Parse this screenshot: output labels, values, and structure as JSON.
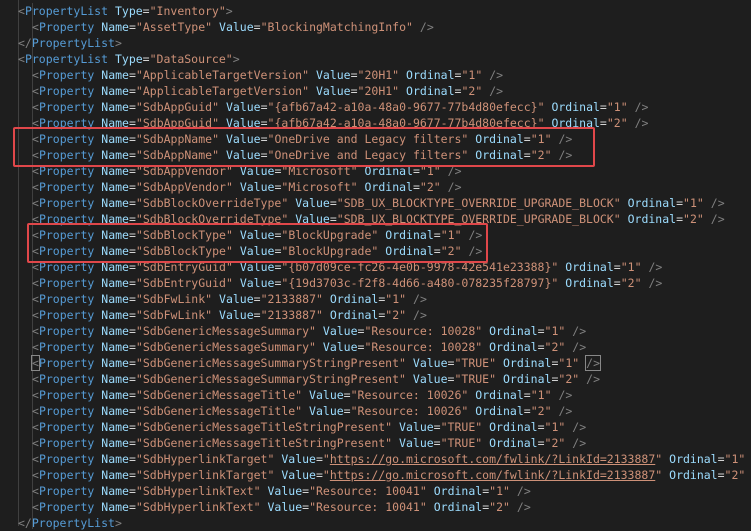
{
  "lines": [
    {
      "indent": 1,
      "kind": "open",
      "tag": "PropertyList",
      "attrs": [
        {
          "name": "Type",
          "value": "Inventory"
        }
      ]
    },
    {
      "indent": 2,
      "kind": "self",
      "tag": "Property",
      "attrs": [
        {
          "name": "Name",
          "value": "AssetType"
        },
        {
          "name": "Value",
          "value": "BlockingMatchingInfo"
        }
      ]
    },
    {
      "indent": 1,
      "kind": "close",
      "tag": "PropertyList",
      "attrs": []
    },
    {
      "indent": 1,
      "kind": "open",
      "tag": "PropertyList",
      "attrs": [
        {
          "name": "Type",
          "value": "DataSource"
        }
      ]
    },
    {
      "indent": 2,
      "kind": "self",
      "tag": "Property",
      "attrs": [
        {
          "name": "Name",
          "value": "ApplicableTargetVersion"
        },
        {
          "name": "Value",
          "value": "20H1"
        },
        {
          "name": "Ordinal",
          "value": "1"
        }
      ]
    },
    {
      "indent": 2,
      "kind": "self",
      "tag": "Property",
      "attrs": [
        {
          "name": "Name",
          "value": "ApplicableTargetVersion"
        },
        {
          "name": "Value",
          "value": "20H1"
        },
        {
          "name": "Ordinal",
          "value": "2"
        }
      ]
    },
    {
      "indent": 2,
      "kind": "self",
      "tag": "Property",
      "attrs": [
        {
          "name": "Name",
          "value": "SdbAppGuid"
        },
        {
          "name": "Value",
          "value": "{afb67a42-a10a-48a0-9677-77b4d80efecc}"
        },
        {
          "name": "Ordinal",
          "value": "1"
        }
      ]
    },
    {
      "indent": 2,
      "kind": "self",
      "tag": "Property",
      "attrs": [
        {
          "name": "Name",
          "value": "SdbAppGuid"
        },
        {
          "name": "Value",
          "value": "{afb67a42-a10a-48a0-9677-77b4d80efecc}"
        },
        {
          "name": "Ordinal",
          "value": "2"
        }
      ]
    },
    {
      "indent": 2,
      "kind": "self",
      "tag": "Property",
      "attrs": [
        {
          "name": "Name",
          "value": "SdbAppName"
        },
        {
          "name": "Value",
          "value": "OneDrive and Legacy filters"
        },
        {
          "name": "Ordinal",
          "value": "1"
        }
      ]
    },
    {
      "indent": 2,
      "kind": "self",
      "tag": "Property",
      "attrs": [
        {
          "name": "Name",
          "value": "SdbAppName"
        },
        {
          "name": "Value",
          "value": "OneDrive and Legacy filters"
        },
        {
          "name": "Ordinal",
          "value": "2"
        }
      ]
    },
    {
      "indent": 2,
      "kind": "self",
      "tag": "Property",
      "attrs": [
        {
          "name": "Name",
          "value": "SdbAppVendor"
        },
        {
          "name": "Value",
          "value": "Microsoft"
        },
        {
          "name": "Ordinal",
          "value": "1"
        }
      ]
    },
    {
      "indent": 2,
      "kind": "self",
      "tag": "Property",
      "attrs": [
        {
          "name": "Name",
          "value": "SdbAppVendor"
        },
        {
          "name": "Value",
          "value": "Microsoft"
        },
        {
          "name": "Ordinal",
          "value": "2"
        }
      ]
    },
    {
      "indent": 2,
      "kind": "self",
      "tag": "Property",
      "attrs": [
        {
          "name": "Name",
          "value": "SdbBlockOverrideType"
        },
        {
          "name": "Value",
          "value": "SDB_UX_BLOCKTYPE_OVERRIDE_UPGRADE_BLOCK"
        },
        {
          "name": "Ordinal",
          "value": "1"
        }
      ]
    },
    {
      "indent": 2,
      "kind": "self",
      "tag": "Property",
      "attrs": [
        {
          "name": "Name",
          "value": "SdbBlockOverrideType"
        },
        {
          "name": "Value",
          "value": "SDB_UX_BLOCKTYPE_OVERRIDE_UPGRADE_BLOCK"
        },
        {
          "name": "Ordinal",
          "value": "2"
        }
      ]
    },
    {
      "indent": 2,
      "kind": "self",
      "tag": "Property",
      "attrs": [
        {
          "name": "Name",
          "value": "SdbBlockType"
        },
        {
          "name": "Value",
          "value": "BlockUpgrade"
        },
        {
          "name": "Ordinal",
          "value": "1"
        }
      ]
    },
    {
      "indent": 2,
      "kind": "self",
      "tag": "Property",
      "attrs": [
        {
          "name": "Name",
          "value": "SdbBlockType"
        },
        {
          "name": "Value",
          "value": "BlockUpgrade"
        },
        {
          "name": "Ordinal",
          "value": "2"
        }
      ]
    },
    {
      "indent": 2,
      "kind": "self",
      "tag": "Property",
      "attrs": [
        {
          "name": "Name",
          "value": "SdbEntryGuid"
        },
        {
          "name": "Value",
          "value": "{b07d09ce-fc26-4e0b-9978-42e541e23388}"
        },
        {
          "name": "Ordinal",
          "value": "1"
        }
      ]
    },
    {
      "indent": 2,
      "kind": "self",
      "tag": "Property",
      "attrs": [
        {
          "name": "Name",
          "value": "SdbEntryGuid"
        },
        {
          "name": "Value",
          "value": "{19d3703c-f2f8-4d66-a480-078235f28797}"
        },
        {
          "name": "Ordinal",
          "value": "2"
        }
      ]
    },
    {
      "indent": 2,
      "kind": "self",
      "tag": "Property",
      "attrs": [
        {
          "name": "Name",
          "value": "SdbFwLink"
        },
        {
          "name": "Value",
          "value": "2133887"
        },
        {
          "name": "Ordinal",
          "value": "1"
        }
      ]
    },
    {
      "indent": 2,
      "kind": "self",
      "tag": "Property",
      "attrs": [
        {
          "name": "Name",
          "value": "SdbFwLink"
        },
        {
          "name": "Value",
          "value": "2133887"
        },
        {
          "name": "Ordinal",
          "value": "2"
        }
      ]
    },
    {
      "indent": 2,
      "kind": "self",
      "tag": "Property",
      "attrs": [
        {
          "name": "Name",
          "value": "SdbGenericMessageSummary"
        },
        {
          "name": "Value",
          "value": "Resource: 10028"
        },
        {
          "name": "Ordinal",
          "value": "1"
        }
      ]
    },
    {
      "indent": 2,
      "kind": "self",
      "tag": "Property",
      "attrs": [
        {
          "name": "Name",
          "value": "SdbGenericMessageSummary"
        },
        {
          "name": "Value",
          "value": "Resource: 10028"
        },
        {
          "name": "Ordinal",
          "value": "2"
        }
      ]
    },
    {
      "indent": 2,
      "kind": "self",
      "tag": "Property",
      "attrs": [
        {
          "name": "Name",
          "value": "SdbGenericMessageSummaryStringPresent"
        },
        {
          "name": "Value",
          "value": "TRUE"
        },
        {
          "name": "Ordinal",
          "value": "1"
        }
      ],
      "bracket_match": true
    },
    {
      "indent": 2,
      "kind": "self",
      "tag": "Property",
      "attrs": [
        {
          "name": "Name",
          "value": "SdbGenericMessageSummaryStringPresent"
        },
        {
          "name": "Value",
          "value": "TRUE"
        },
        {
          "name": "Ordinal",
          "value": "2"
        }
      ]
    },
    {
      "indent": 2,
      "kind": "self",
      "tag": "Property",
      "attrs": [
        {
          "name": "Name",
          "value": "SdbGenericMessageTitle"
        },
        {
          "name": "Value",
          "value": "Resource: 10026"
        },
        {
          "name": "Ordinal",
          "value": "1"
        }
      ]
    },
    {
      "indent": 2,
      "kind": "self",
      "tag": "Property",
      "attrs": [
        {
          "name": "Name",
          "value": "SdbGenericMessageTitle"
        },
        {
          "name": "Value",
          "value": "Resource: 10026"
        },
        {
          "name": "Ordinal",
          "value": "2"
        }
      ]
    },
    {
      "indent": 2,
      "kind": "self",
      "tag": "Property",
      "attrs": [
        {
          "name": "Name",
          "value": "SdbGenericMessageTitleStringPresent"
        },
        {
          "name": "Value",
          "value": "TRUE"
        },
        {
          "name": "Ordinal",
          "value": "1"
        }
      ]
    },
    {
      "indent": 2,
      "kind": "self",
      "tag": "Property",
      "attrs": [
        {
          "name": "Name",
          "value": "SdbGenericMessageTitleStringPresent"
        },
        {
          "name": "Value",
          "value": "TRUE"
        },
        {
          "name": "Ordinal",
          "value": "2"
        }
      ]
    },
    {
      "indent": 2,
      "kind": "self",
      "tag": "Property",
      "attrs": [
        {
          "name": "Name",
          "value": "SdbHyperlinkTarget"
        },
        {
          "name": "Value",
          "value": "https://go.microsoft.com/fwlink/?LinkId=2133887",
          "link": true
        },
        {
          "name": "Ordinal",
          "value": "1"
        }
      ]
    },
    {
      "indent": 2,
      "kind": "self",
      "tag": "Property",
      "attrs": [
        {
          "name": "Name",
          "value": "SdbHyperlinkTarget"
        },
        {
          "name": "Value",
          "value": "https://go.microsoft.com/fwlink/?LinkId=2133887",
          "link": true
        },
        {
          "name": "Ordinal",
          "value": "2"
        }
      ]
    },
    {
      "indent": 2,
      "kind": "self",
      "tag": "Property",
      "attrs": [
        {
          "name": "Name",
          "value": "SdbHyperlinkText"
        },
        {
          "name": "Value",
          "value": "Resource: 10041"
        },
        {
          "name": "Ordinal",
          "value": "1"
        }
      ]
    },
    {
      "indent": 2,
      "kind": "self",
      "tag": "Property",
      "attrs": [
        {
          "name": "Name",
          "value": "SdbHyperlinkText"
        },
        {
          "name": "Value",
          "value": "Resource: 10041"
        },
        {
          "name": "Ordinal",
          "value": "2"
        }
      ]
    },
    {
      "indent": 1,
      "kind": "close",
      "tag": "PropertyList",
      "attrs": []
    }
  ],
  "highlights": [
    {
      "label": "sdb-app-name-highlight",
      "lines": [
        8,
        9
      ]
    },
    {
      "label": "sdb-block-type-highlight",
      "lines": [
        14,
        15
      ]
    }
  ],
  "colors": {
    "background": "#1e1e1e",
    "tag_bracket": "#808080",
    "tag_name": "#569cd6",
    "attr_name": "#9cdcfe",
    "attr_value": "#ce9178",
    "highlight_border": "#e0474a"
  }
}
